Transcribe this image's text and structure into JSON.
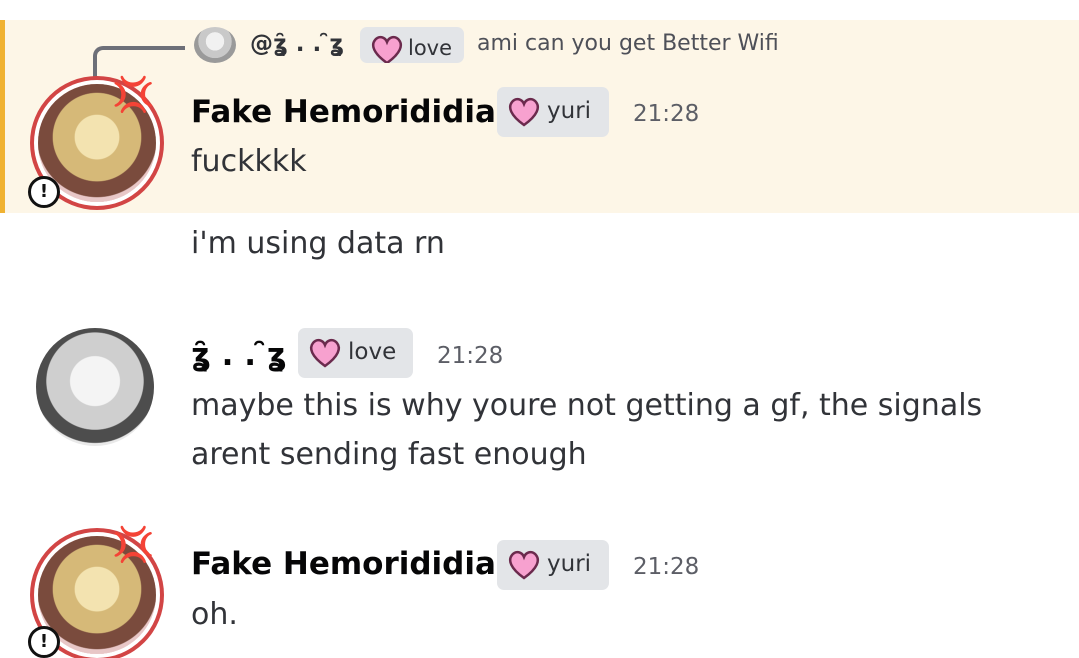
{
  "messages": [
    {
      "reply": {
        "username": "@ʓ̑ . . ̑ʓ",
        "tag": "love",
        "text": "ami can you get Better Wifi"
      },
      "username": "Fake Hemorididian",
      "tag": "yuri",
      "timestamp": "21:28",
      "lines": [
        "fuckkkk",
        "i'm using data rn"
      ]
    },
    {
      "username": "ʓ̑ . . ̑ʓ",
      "tag": "love",
      "timestamp": "21:28",
      "lines": [
        "maybe this is why youre not getting a gf, the signals",
        "arent sending fast enough"
      ]
    },
    {
      "username": "Fake Hemorididian",
      "tag": "yuri",
      "timestamp": "21:28",
      "lines": [
        "oh."
      ]
    }
  ],
  "colors": {
    "highlight_bg": "#fdf6e7",
    "highlight_bar": "#f0b232",
    "tag_bg": "#e3e5e8"
  },
  "icons": {
    "tag": "pink-heart-icon",
    "alert": "exclamation-icon",
    "status": "anger-symbol-icon"
  }
}
